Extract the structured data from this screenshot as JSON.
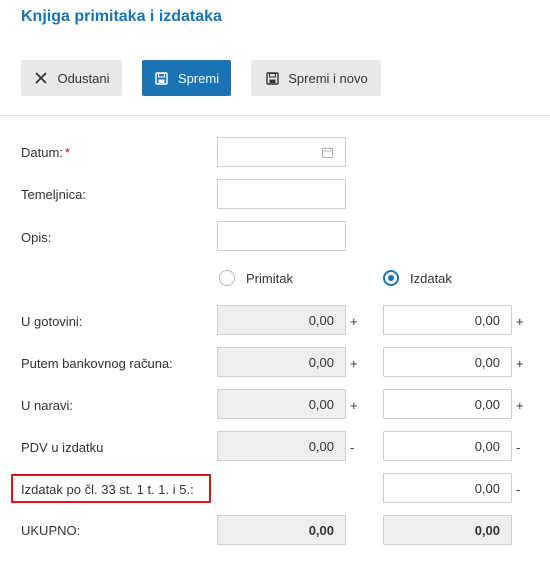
{
  "header": {
    "title": "Knjiga primitaka i izdataka"
  },
  "toolbar": {
    "cancel_label": "Odustani",
    "save_label": "Spremi",
    "save_new_label": "Spremi i novo"
  },
  "form": {
    "date_label": "Datum:",
    "required_mark": "*",
    "ledger_label": "Temeljnica:",
    "description_label": "Opis:",
    "date_value": "",
    "ledger_value": "",
    "description_value": ""
  },
  "type": {
    "options": [
      "Primitak",
      "Izdatak"
    ],
    "selected": "Izdatak"
  },
  "rows": [
    {
      "label": "U gotovini:",
      "left": "0,00",
      "left_op": "+",
      "right": "0,00",
      "right_op": "+"
    },
    {
      "label": "Putem bankovnog računa:",
      "left": "0,00",
      "left_op": "+",
      "right": "0,00",
      "right_op": "+"
    },
    {
      "label": "U naravi:",
      "left": "0,00",
      "left_op": "+",
      "right": "0,00",
      "right_op": "+"
    },
    {
      "label": "PDV u izdatku",
      "left": "0,00",
      "left_op": "-",
      "right": "0,00",
      "right_op": "-"
    },
    {
      "label": "Izdatak po čl. 33 st. 1 t. 1. i 5.:",
      "right": "0,00",
      "right_op": "-"
    }
  ],
  "total": {
    "label": "UKUPNO:",
    "left": "0,00",
    "right": "0,00"
  },
  "colors": {
    "accent": "#1a73b5",
    "highlight": "#d6161c",
    "required": "#d0021b"
  }
}
